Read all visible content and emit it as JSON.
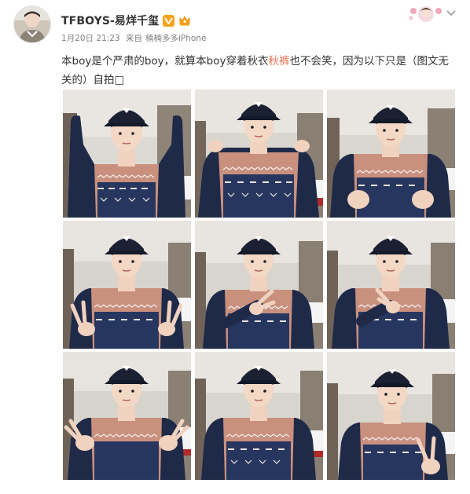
{
  "post": {
    "author": {
      "name": "TFBOYS-易烊千玺",
      "avatar_icon": "user-avatar-icon",
      "verified_icon": "verified-v-icon",
      "member_icon": "crown-member-icon"
    },
    "meta": {
      "date": "1月20日 21:23",
      "source_prefix": "来自",
      "source": "楠楠多多iPhone"
    },
    "text": {
      "part1": "本boy是个严肃的boy，就算本boy穿着秋衣",
      "highlight": "秋裤",
      "part2": "也不会笑，因为以下只是（图文无关的）自拍",
      "emoji": "□"
    },
    "photos_count": 9
  },
  "colors": {
    "link_orange": "#eb7350",
    "meta_gray": "#808080",
    "badge_orange": "#f7a21b",
    "sweater_pink": "#c9907e",
    "sweater_navy": "#1f2a48",
    "cap_navy": "#1b2133"
  }
}
